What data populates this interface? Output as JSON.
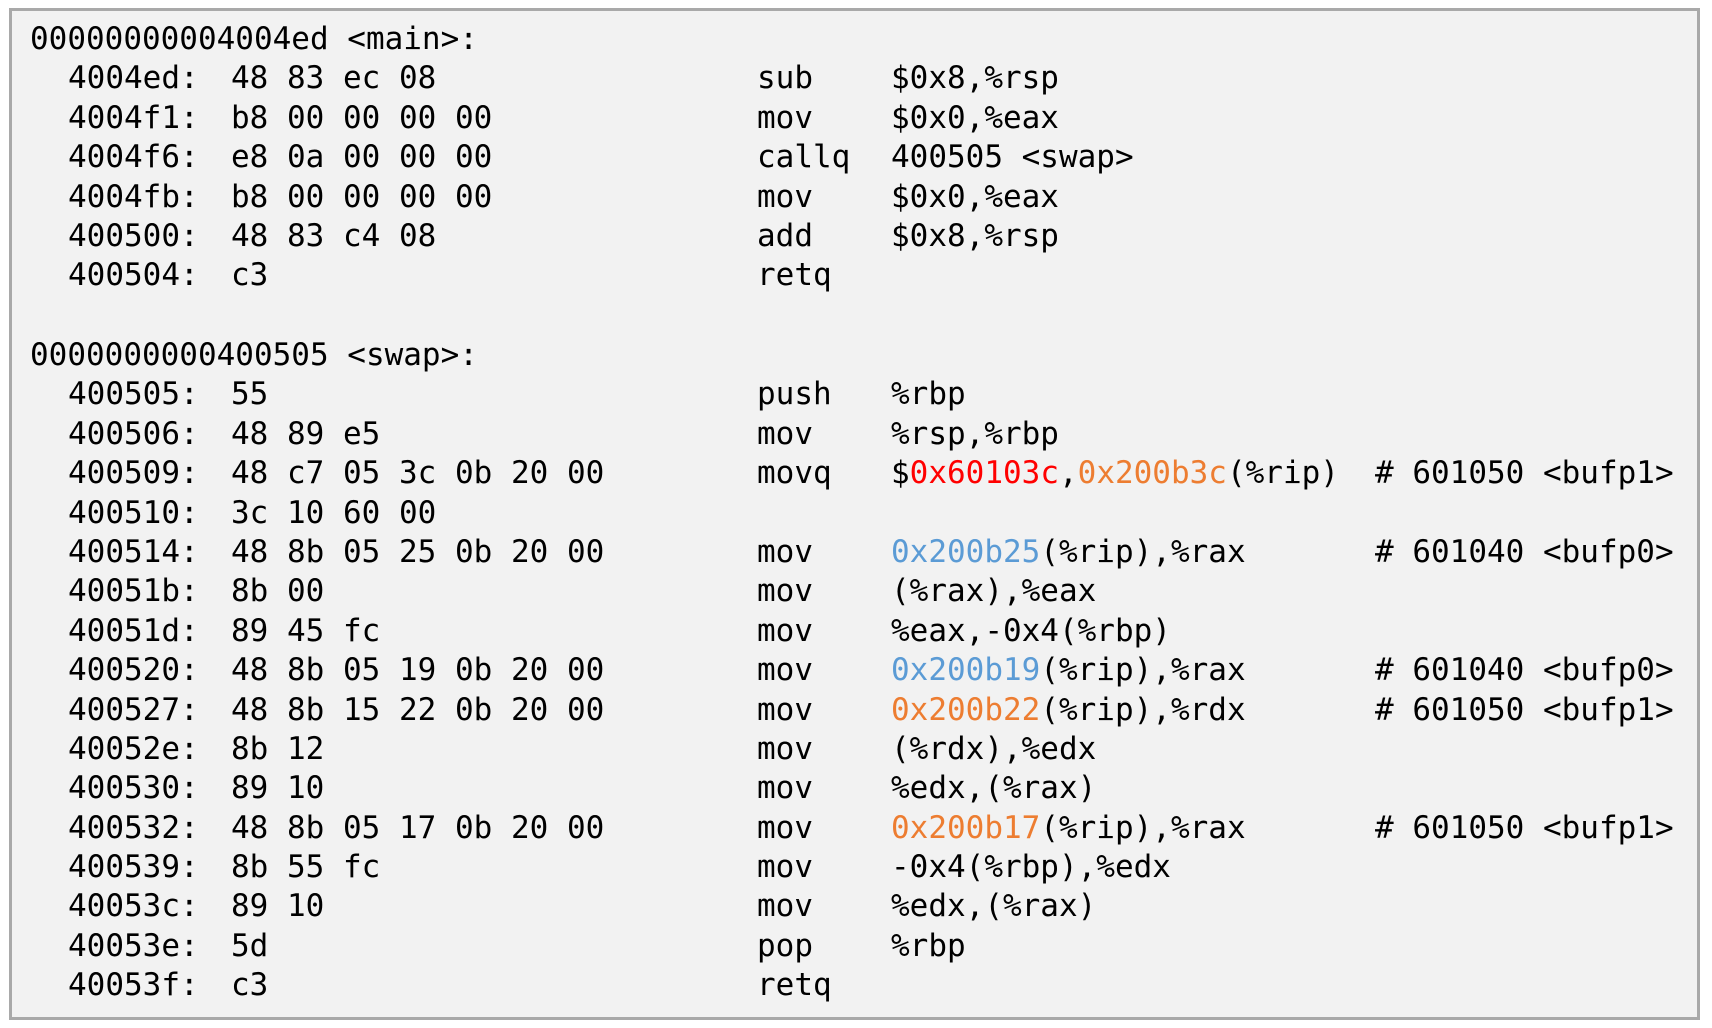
{
  "colors": {
    "background": "#f2f2f2",
    "border": "#a9a9a9",
    "text": "#000000",
    "red": "#ff0000",
    "orange": "#ed7d31",
    "blue": "#5b9bd5"
  },
  "main": {
    "header": "00000000004004ed <main>:",
    "rows": [
      {
        "addr": "4004ed:",
        "bytes": "48 83 ec 08",
        "mnemonic": "sub",
        "ops_a": "$0x8,%rsp",
        "ops_hl": "",
        "ops_b": "",
        "ops_hl2": "",
        "ops_c": "",
        "comment": ""
      },
      {
        "addr": "4004f1:",
        "bytes": "b8 00 00 00 00",
        "mnemonic": "mov",
        "ops_a": "$0x0,%eax",
        "ops_hl": "",
        "ops_b": "",
        "ops_hl2": "",
        "ops_c": "",
        "comment": ""
      },
      {
        "addr": "4004f6:",
        "bytes": "e8 0a 00 00 00",
        "mnemonic": "callq",
        "ops_a": "400505 <swap>",
        "ops_hl": "",
        "ops_b": "",
        "ops_hl2": "",
        "ops_c": "",
        "comment": ""
      },
      {
        "addr": "4004fb:",
        "bytes": "b8 00 00 00 00",
        "mnemonic": "mov",
        "ops_a": "$0x0,%eax",
        "ops_hl": "",
        "ops_b": "",
        "ops_hl2": "",
        "ops_c": "",
        "comment": ""
      },
      {
        "addr": "400500:",
        "bytes": "48 83 c4 08",
        "mnemonic": "add",
        "ops_a": "$0x8,%rsp",
        "ops_hl": "",
        "ops_b": "",
        "ops_hl2": "",
        "ops_c": "",
        "comment": ""
      },
      {
        "addr": "400504:",
        "bytes": "c3",
        "mnemonic": "retq",
        "ops_a": "",
        "ops_hl": "",
        "ops_b": "",
        "ops_hl2": "",
        "ops_c": "",
        "comment": ""
      }
    ]
  },
  "swap": {
    "header": "0000000000400505 <swap>:",
    "rows": [
      {
        "addr": "400505:",
        "bytes": "55",
        "mnemonic": "push",
        "ops_a": "%rbp",
        "ops_hl": "",
        "ops_b": "",
        "ops_hl2": "",
        "ops_c": "",
        "comment": ""
      },
      {
        "addr": "400506:",
        "bytes": "48 89 e5",
        "mnemonic": "mov",
        "ops_a": "%rsp,%rbp",
        "ops_hl": "",
        "ops_b": "",
        "ops_hl2": "",
        "ops_c": "",
        "comment": ""
      },
      {
        "addr": "400509:",
        "bytes": "48 c7 05 3c 0b 20 00",
        "mnemonic": "movq",
        "ops_a": "$",
        "ops_hl": "0x60103c",
        "ops_b": ",",
        "ops_hl2": "0x200b3c",
        "ops_c": "(%rip)",
        "comment": "# 601050 <bufp1>"
      },
      {
        "addr": "400510:",
        "bytes": "3c 10 60 00",
        "mnemonic": "",
        "ops_a": "",
        "ops_hl": "",
        "ops_b": "",
        "ops_hl2": "",
        "ops_c": "",
        "comment": ""
      },
      {
        "addr": "400514:",
        "bytes": "48 8b 05 25 0b 20 00",
        "mnemonic": "mov",
        "ops_a": "",
        "ops_hl": "0x200b25",
        "ops_b": "(%rip),%rax",
        "ops_hl2": "",
        "ops_c": "",
        "comment": "# 601040 <bufp0>"
      },
      {
        "addr": "40051b:",
        "bytes": "8b 00",
        "mnemonic": "mov",
        "ops_a": "(%rax),%eax",
        "ops_hl": "",
        "ops_b": "",
        "ops_hl2": "",
        "ops_c": "",
        "comment": ""
      },
      {
        "addr": "40051d:",
        "bytes": "89 45 fc",
        "mnemonic": "mov",
        "ops_a": "%eax,-0x4(%rbp)",
        "ops_hl": "",
        "ops_b": "",
        "ops_hl2": "",
        "ops_c": "",
        "comment": ""
      },
      {
        "addr": "400520:",
        "bytes": "48 8b 05 19 0b 20 00",
        "mnemonic": "mov",
        "ops_a": "",
        "ops_hl": "0x200b19",
        "ops_b": "(%rip),%rax",
        "ops_hl2": "",
        "ops_c": "",
        "comment": "# 601040 <bufp0>"
      },
      {
        "addr": "400527:",
        "bytes": "48 8b 15 22 0b 20 00",
        "mnemonic": "mov",
        "ops_a": "",
        "ops_hl": "0x200b22",
        "ops_b": "(%rip),%rdx",
        "ops_hl2": "",
        "ops_c": "",
        "comment": "# 601050 <bufp1>"
      },
      {
        "addr": "40052e:",
        "bytes": "8b 12",
        "mnemonic": "mov",
        "ops_a": "(%rdx),%edx",
        "ops_hl": "",
        "ops_b": "",
        "ops_hl2": "",
        "ops_c": "",
        "comment": ""
      },
      {
        "addr": "400530:",
        "bytes": "89 10",
        "mnemonic": "mov",
        "ops_a": "%edx,(%rax)",
        "ops_hl": "",
        "ops_b": "",
        "ops_hl2": "",
        "ops_c": "",
        "comment": ""
      },
      {
        "addr": "400532:",
        "bytes": "48 8b 05 17 0b 20 00",
        "mnemonic": "mov",
        "ops_a": "",
        "ops_hl": "0x200b17",
        "ops_b": "(%rip),%rax",
        "ops_hl2": "",
        "ops_c": "",
        "comment": "# 601050 <bufp1>"
      },
      {
        "addr": "400539:",
        "bytes": "8b 55 fc",
        "mnemonic": "mov",
        "ops_a": "-0x4(%rbp),%edx",
        "ops_hl": "",
        "ops_b": "",
        "ops_hl2": "",
        "ops_c": "",
        "comment": ""
      },
      {
        "addr": "40053c:",
        "bytes": "89 10",
        "mnemonic": "mov",
        "ops_a": "%edx,(%rax)",
        "ops_hl": "",
        "ops_b": "",
        "ops_hl2": "",
        "ops_c": "",
        "comment": ""
      },
      {
        "addr": "40053e:",
        "bytes": "5d",
        "mnemonic": "pop",
        "ops_a": "%rbp",
        "ops_hl": "",
        "ops_b": "",
        "ops_hl2": "",
        "ops_c": "",
        "comment": ""
      },
      {
        "addr": "40053f:",
        "bytes": "c3",
        "mnemonic": "retq",
        "ops_a": "",
        "ops_hl": "",
        "ops_b": "",
        "ops_hl2": "",
        "ops_c": "",
        "comment": ""
      }
    ]
  }
}
